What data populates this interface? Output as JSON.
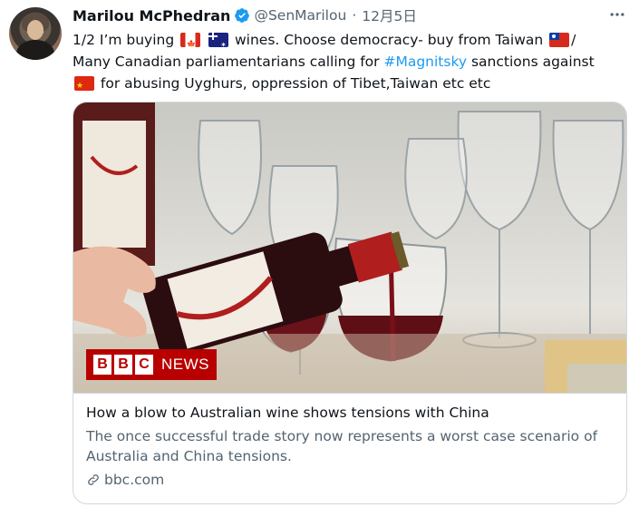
{
  "tweet": {
    "author_name": "Marilou McPhedran",
    "handle": "@SenMarilou",
    "separator": "·",
    "date": "12月5日",
    "more_icon": "⊙⊙⊙",
    "line1_a": "1/2 I’m buying ",
    "line1_b": " wines. Choose democracy- buy from Taiwan ",
    "line1_c": "/",
    "line2_a": "Many Canadian parliamentarians calling for ",
    "hashtag": "#Magnitsky",
    "line2_b": " sanctions against",
    "line3": " for abusing Uyghurs, oppression of Tibet,Taiwan etc etc",
    "flags": [
      "canada-flag",
      "australia-flag",
      "taiwan-flag",
      "china-flag"
    ]
  },
  "card": {
    "logo_letters": [
      "B",
      "B",
      "C"
    ],
    "logo_word": "NEWS",
    "title": "How a blow to Australian wine shows tensions with China",
    "desc_line1": "The once successful trade story now represents a worst case scenario of",
    "desc_line2": "Australia and China tensions.",
    "domain": "bbc.com"
  },
  "colors": {
    "link": "#1d9bf0",
    "secondary": "#536471",
    "bbc_red": "#b80000"
  }
}
